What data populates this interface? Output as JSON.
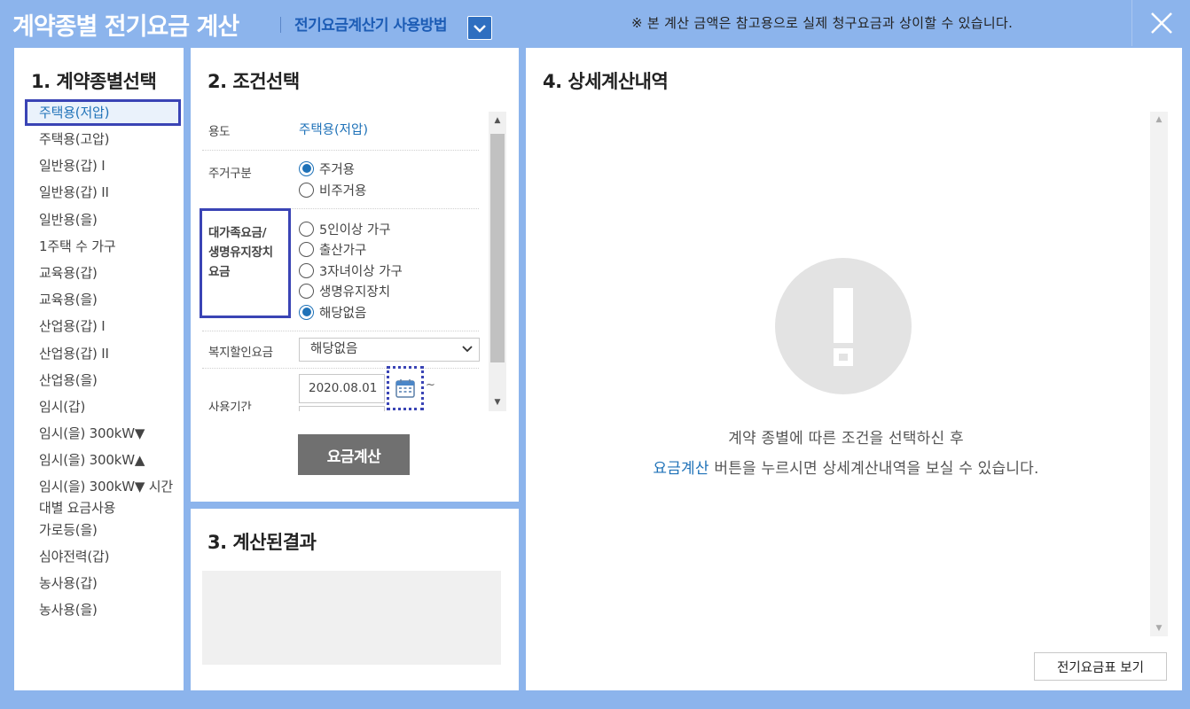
{
  "header": {
    "title": "계약종별 전기요금 계산",
    "howto_label": "전기요금계산기 사용방법",
    "notice": "※ 본 계산 금액은 참고용으로 실제 청구요금과 상이할 수 있습니다.",
    "accent_color": "#8cb4ec"
  },
  "section1": {
    "title": "1. 계약종별선택",
    "selected": "주택용(저압)",
    "items": [
      "주택용(저압)",
      "주택용(고압)",
      "일반용(갑) I",
      "일반용(갑) II",
      "일반용(을)",
      "1주택 수 가구",
      "교육용(갑)",
      "교육용(을)",
      "산업용(갑) I",
      "산업용(갑) II",
      "산업용(을)",
      "임시(갑)",
      "임시(을) 300kW▼",
      "임시(을) 300kW▲",
      "임시(을) 300kW▼ 시간대별 요금사용",
      "가로등(을)",
      "심야전력(갑)",
      "농사용(갑)",
      "농사용(을)"
    ]
  },
  "section2": {
    "title": "2. 조건선택",
    "usage_label": "용도",
    "usage_value": "주택용(저압)",
    "residence_label": "주거구분",
    "residence_options": [
      "주거용",
      "비주거용"
    ],
    "residence_selected": "주거용",
    "family_label_line1": "대가족요금/",
    "family_label_line2": "생명유지장치",
    "family_label_line3": "요금",
    "family_options": [
      "5인이상 가구",
      "출산가구",
      "3자녀이상 가구",
      "생명유지장치",
      "해당없음"
    ],
    "family_selected": "해당없음",
    "welfare_label": "복지할인요금",
    "welfare_value": "해당없음",
    "period_label": "사용기간",
    "period_start": "2020.08.01",
    "period_separator": "~",
    "calc_button": "요금계산"
  },
  "section3": {
    "title": "3. 계산된결과"
  },
  "section4": {
    "title": "4. 상세계산내역",
    "message_line1": "계약 종별에 따른 조건을 선택하신 후",
    "message_link": "요금계산",
    "message_line2_rest": " 버튼을 누르시면 상세계산내역을 보실 수 있습니다.",
    "rate_table_button": "전기요금표 보기"
  }
}
